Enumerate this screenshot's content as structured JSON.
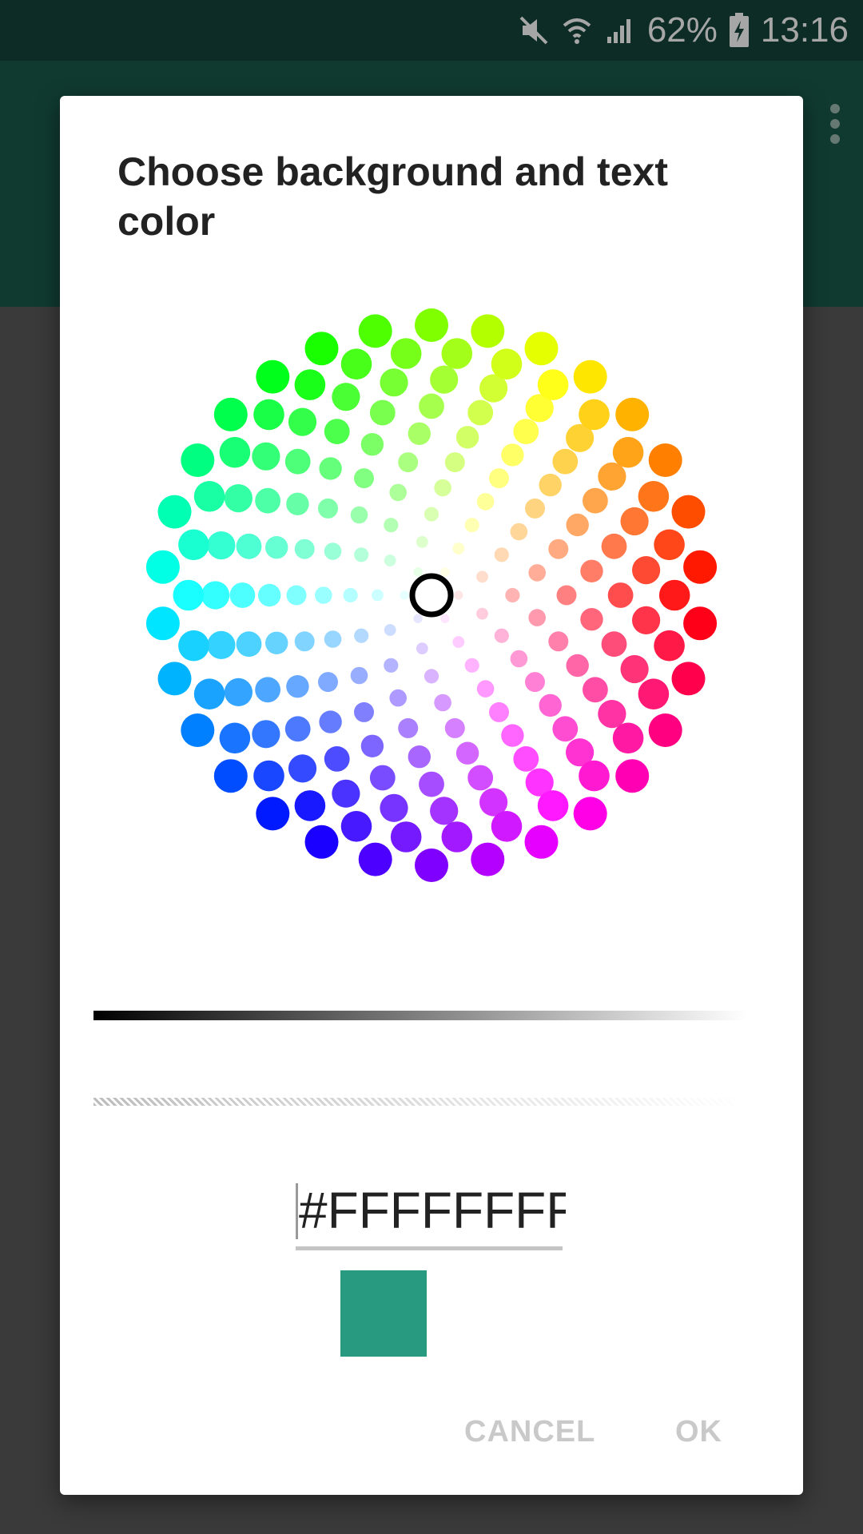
{
  "status_bar": {
    "battery_percent": "62%",
    "time": "13:16",
    "icons": [
      "mute-icon",
      "wifi-icon",
      "signal-icon",
      "battery-charging-icon"
    ]
  },
  "app_bar": {
    "color": "#1a5a4a",
    "overflow_icon": "more-vert-icon"
  },
  "dialog": {
    "title": "Choose background and text color",
    "hex_value": "#FFFFFFFF",
    "swatch_color": "#289a80",
    "cancel_label": "CANCEL",
    "ok_label": "OK",
    "selector_icon": "selected-color-ring-icon"
  },
  "color_wheel": {
    "rings": 10,
    "dots_per_ring": [
      6,
      9,
      12,
      15,
      18,
      21,
      24,
      27,
      30,
      30
    ],
    "selected_color": "#FFFFFF"
  }
}
